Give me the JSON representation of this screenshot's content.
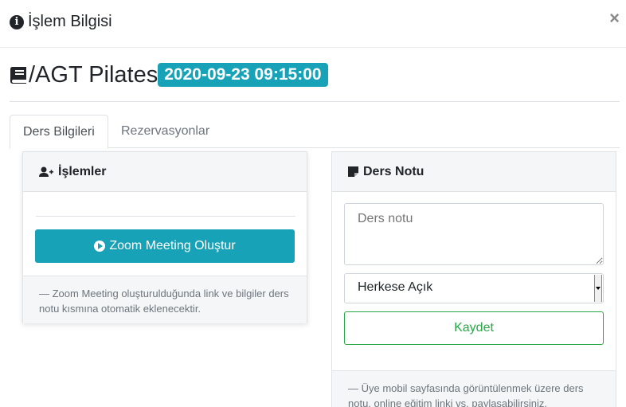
{
  "modal": {
    "title": "İşlem Bilgisi",
    "close_symbol": "×"
  },
  "lesson": {
    "name": "/AGT Pilates",
    "datetime": "2020-09-23 09:15:00"
  },
  "tabs": [
    {
      "label": "Ders Bilgileri",
      "active": true
    },
    {
      "label": "Rezervasyonlar",
      "active": false
    }
  ],
  "actions_card": {
    "title": "İşlemler",
    "zoom_button_label": "Zoom Meeting Oluştur",
    "footer_note": "—  Zoom Meeting oluşturulduğunda link ve bilgiler ders notu kısmına otomatik eklenecektir."
  },
  "note_card": {
    "title": "Ders Notu",
    "note_placeholder": "Ders notu",
    "note_value": "",
    "visibility_selected": "Herkese Açık",
    "save_button_label": "Kaydet",
    "footer_note": "—  Üye mobil sayfasında görüntülenmek üzere ders notu, online eğitim linki vs. paylaşabilirsiniz."
  },
  "colors": {
    "accent": "#17a2b8",
    "success": "#28a745",
    "muted": "#6c757d"
  },
  "icons": [
    "info-circle-icon",
    "close-icon",
    "book-icon",
    "user-plus-icon",
    "play-circle-icon",
    "sticky-note-icon",
    "chevron-down-icon"
  ]
}
